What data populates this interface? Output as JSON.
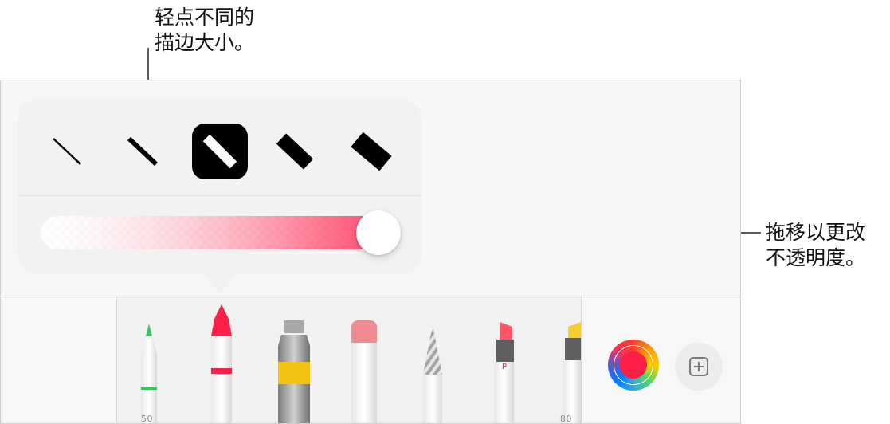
{
  "callouts": {
    "stroke_size": "轻点不同的\n描边大小。",
    "opacity": "拖移以更改\n不透明度。"
  },
  "colors": {
    "accent_red": "#ff1e47",
    "selected_stroke_bg": "#000000"
  },
  "stroke_sizes": {
    "count": 5,
    "selected_index": 2
  },
  "opacity": {
    "value": 1.0
  },
  "tools": {
    "pen": {
      "label": "50"
    },
    "crayon": {
      "label": ""
    },
    "paint": {
      "label": ""
    },
    "eraser": {
      "label": ""
    },
    "pencil": {
      "label": ""
    },
    "marker": {
      "label": "P"
    },
    "highlighter": {
      "label": "80"
    }
  },
  "toolbar": {
    "color_button": "color-picker",
    "add_tool_button": "add-tool"
  }
}
